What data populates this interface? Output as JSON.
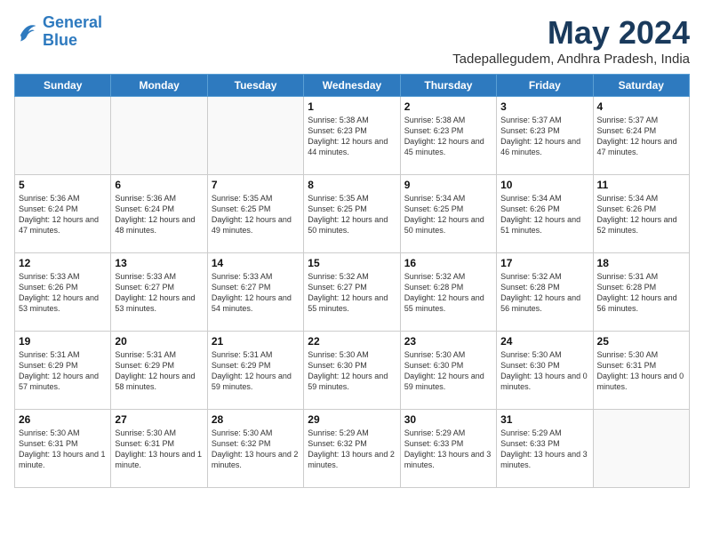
{
  "header": {
    "logo_line1": "General",
    "logo_line2": "Blue",
    "month": "May 2024",
    "location": "Tadepallegudem, Andhra Pradesh, India"
  },
  "weekdays": [
    "Sunday",
    "Monday",
    "Tuesday",
    "Wednesday",
    "Thursday",
    "Friday",
    "Saturday"
  ],
  "weeks": [
    [
      {
        "day": "",
        "sunrise": "",
        "sunset": "",
        "daylight": ""
      },
      {
        "day": "",
        "sunrise": "",
        "sunset": "",
        "daylight": ""
      },
      {
        "day": "",
        "sunrise": "",
        "sunset": "",
        "daylight": ""
      },
      {
        "day": "1",
        "sunrise": "Sunrise: 5:38 AM",
        "sunset": "Sunset: 6:23 PM",
        "daylight": "Daylight: 12 hours and 44 minutes."
      },
      {
        "day": "2",
        "sunrise": "Sunrise: 5:38 AM",
        "sunset": "Sunset: 6:23 PM",
        "daylight": "Daylight: 12 hours and 45 minutes."
      },
      {
        "day": "3",
        "sunrise": "Sunrise: 5:37 AM",
        "sunset": "Sunset: 6:23 PM",
        "daylight": "Daylight: 12 hours and 46 minutes."
      },
      {
        "day": "4",
        "sunrise": "Sunrise: 5:37 AM",
        "sunset": "Sunset: 6:24 PM",
        "daylight": "Daylight: 12 hours and 47 minutes."
      }
    ],
    [
      {
        "day": "5",
        "sunrise": "Sunrise: 5:36 AM",
        "sunset": "Sunset: 6:24 PM",
        "daylight": "Daylight: 12 hours and 47 minutes."
      },
      {
        "day": "6",
        "sunrise": "Sunrise: 5:36 AM",
        "sunset": "Sunset: 6:24 PM",
        "daylight": "Daylight: 12 hours and 48 minutes."
      },
      {
        "day": "7",
        "sunrise": "Sunrise: 5:35 AM",
        "sunset": "Sunset: 6:25 PM",
        "daylight": "Daylight: 12 hours and 49 minutes."
      },
      {
        "day": "8",
        "sunrise": "Sunrise: 5:35 AM",
        "sunset": "Sunset: 6:25 PM",
        "daylight": "Daylight: 12 hours and 50 minutes."
      },
      {
        "day": "9",
        "sunrise": "Sunrise: 5:34 AM",
        "sunset": "Sunset: 6:25 PM",
        "daylight": "Daylight: 12 hours and 50 minutes."
      },
      {
        "day": "10",
        "sunrise": "Sunrise: 5:34 AM",
        "sunset": "Sunset: 6:26 PM",
        "daylight": "Daylight: 12 hours and 51 minutes."
      },
      {
        "day": "11",
        "sunrise": "Sunrise: 5:34 AM",
        "sunset": "Sunset: 6:26 PM",
        "daylight": "Daylight: 12 hours and 52 minutes."
      }
    ],
    [
      {
        "day": "12",
        "sunrise": "Sunrise: 5:33 AM",
        "sunset": "Sunset: 6:26 PM",
        "daylight": "Daylight: 12 hours and 53 minutes."
      },
      {
        "day": "13",
        "sunrise": "Sunrise: 5:33 AM",
        "sunset": "Sunset: 6:27 PM",
        "daylight": "Daylight: 12 hours and 53 minutes."
      },
      {
        "day": "14",
        "sunrise": "Sunrise: 5:33 AM",
        "sunset": "Sunset: 6:27 PM",
        "daylight": "Daylight: 12 hours and 54 minutes."
      },
      {
        "day": "15",
        "sunrise": "Sunrise: 5:32 AM",
        "sunset": "Sunset: 6:27 PM",
        "daylight": "Daylight: 12 hours and 55 minutes."
      },
      {
        "day": "16",
        "sunrise": "Sunrise: 5:32 AM",
        "sunset": "Sunset: 6:28 PM",
        "daylight": "Daylight: 12 hours and 55 minutes."
      },
      {
        "day": "17",
        "sunrise": "Sunrise: 5:32 AM",
        "sunset": "Sunset: 6:28 PM",
        "daylight": "Daylight: 12 hours and 56 minutes."
      },
      {
        "day": "18",
        "sunrise": "Sunrise: 5:31 AM",
        "sunset": "Sunset: 6:28 PM",
        "daylight": "Daylight: 12 hours and 56 minutes."
      }
    ],
    [
      {
        "day": "19",
        "sunrise": "Sunrise: 5:31 AM",
        "sunset": "Sunset: 6:29 PM",
        "daylight": "Daylight: 12 hours and 57 minutes."
      },
      {
        "day": "20",
        "sunrise": "Sunrise: 5:31 AM",
        "sunset": "Sunset: 6:29 PM",
        "daylight": "Daylight: 12 hours and 58 minutes."
      },
      {
        "day": "21",
        "sunrise": "Sunrise: 5:31 AM",
        "sunset": "Sunset: 6:29 PM",
        "daylight": "Daylight: 12 hours and 59 minutes."
      },
      {
        "day": "22",
        "sunrise": "Sunrise: 5:30 AM",
        "sunset": "Sunset: 6:30 PM",
        "daylight": "Daylight: 12 hours and 59 minutes."
      },
      {
        "day": "23",
        "sunrise": "Sunrise: 5:30 AM",
        "sunset": "Sunset: 6:30 PM",
        "daylight": "Daylight: 12 hours and 59 minutes."
      },
      {
        "day": "24",
        "sunrise": "Sunrise: 5:30 AM",
        "sunset": "Sunset: 6:30 PM",
        "daylight": "Daylight: 13 hours and 0 minutes."
      },
      {
        "day": "25",
        "sunrise": "Sunrise: 5:30 AM",
        "sunset": "Sunset: 6:31 PM",
        "daylight": "Daylight: 13 hours and 0 minutes."
      }
    ],
    [
      {
        "day": "26",
        "sunrise": "Sunrise: 5:30 AM",
        "sunset": "Sunset: 6:31 PM",
        "daylight": "Daylight: 13 hours and 1 minute."
      },
      {
        "day": "27",
        "sunrise": "Sunrise: 5:30 AM",
        "sunset": "Sunset: 6:31 PM",
        "daylight": "Daylight: 13 hours and 1 minute."
      },
      {
        "day": "28",
        "sunrise": "Sunrise: 5:30 AM",
        "sunset": "Sunset: 6:32 PM",
        "daylight": "Daylight: 13 hours and 2 minutes."
      },
      {
        "day": "29",
        "sunrise": "Sunrise: 5:29 AM",
        "sunset": "Sunset: 6:32 PM",
        "daylight": "Daylight: 13 hours and 2 minutes."
      },
      {
        "day": "30",
        "sunrise": "Sunrise: 5:29 AM",
        "sunset": "Sunset: 6:33 PM",
        "daylight": "Daylight: 13 hours and 3 minutes."
      },
      {
        "day": "31",
        "sunrise": "Sunrise: 5:29 AM",
        "sunset": "Sunset: 6:33 PM",
        "daylight": "Daylight: 13 hours and 3 minutes."
      },
      {
        "day": "",
        "sunrise": "",
        "sunset": "",
        "daylight": ""
      }
    ]
  ]
}
